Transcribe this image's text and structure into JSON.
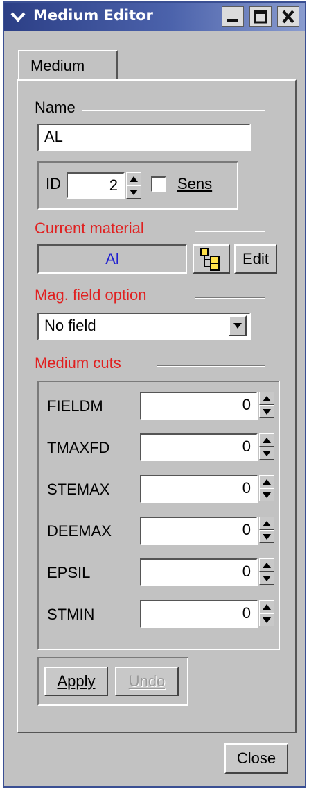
{
  "window": {
    "title": "Medium Editor",
    "menu_icon": "chevron-down-icon",
    "controls": {
      "minimize": "_",
      "maximize": "□",
      "close": "✕"
    }
  },
  "tabs": [
    {
      "label": "Medium"
    }
  ],
  "name_section": {
    "label": "Name",
    "value": "AL"
  },
  "id_section": {
    "label": "ID",
    "value": "2",
    "sens_label": "Sens",
    "sens_checked": false
  },
  "material": {
    "label": "Current material",
    "value": "Al",
    "browse_icon": "tree-browser-icon",
    "edit_label": "Edit"
  },
  "mag_field": {
    "label": "Mag. field option",
    "selected": "No field"
  },
  "cuts": {
    "label": "Medium cuts",
    "rows": [
      {
        "name": "FIELDM",
        "value": "0"
      },
      {
        "name": "TMAXFD",
        "value": "0"
      },
      {
        "name": "STEMAX",
        "value": "0"
      },
      {
        "name": "DEEMAX",
        "value": "0"
      },
      {
        "name": "EPSIL",
        "value": "0"
      },
      {
        "name": "STMIN",
        "value": "0"
      }
    ]
  },
  "actions": {
    "apply_label": "Apply",
    "undo_label": "Undo"
  },
  "footer": {
    "close_label": "Close"
  },
  "colors": {
    "title_bar": "#2c3f86",
    "section_label": "#e02020",
    "material_text": "#2020d0",
    "background": "#c2c2c2"
  }
}
